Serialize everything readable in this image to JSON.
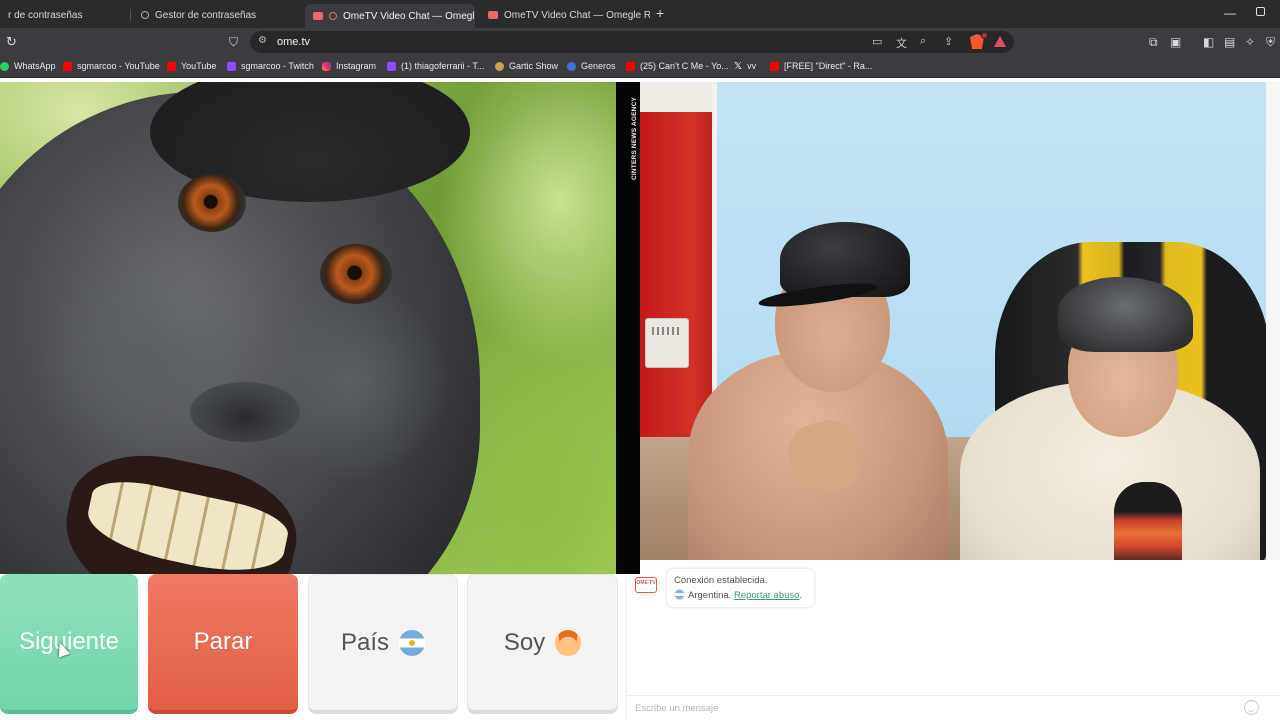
{
  "browser": {
    "tabs": [
      {
        "title": "r de contraseñas"
      },
      {
        "title": "Gestor de contraseñas"
      },
      {
        "title": "OmeTV Video Chat — Omegl",
        "active": true
      },
      {
        "title": "OmeTV Video Chat — Omegle Rand"
      }
    ],
    "url": "ome.tv",
    "bookmarks": [
      {
        "label": "WhatsApp",
        "icon": "whatsapp-icon"
      },
      {
        "label": "sgmarcoo - YouTube",
        "icon": "youtube-icon"
      },
      {
        "label": "YouTube",
        "icon": "youtube-icon"
      },
      {
        "label": "sgmarcoo - Twitch",
        "icon": "twitch-icon"
      },
      {
        "label": "Instagram",
        "icon": "instagram-icon"
      },
      {
        "label": "(1) thiagoferrarii - T...",
        "icon": "twitch-icon"
      },
      {
        "label": "Gartic Show",
        "icon": "gartic-icon"
      },
      {
        "label": "Generos",
        "icon": "globe-icon"
      },
      {
        "label": "(25) Can't C Me - Yo...",
        "icon": "youtube-icon"
      },
      {
        "label": "vv",
        "icon": "x-icon"
      },
      {
        "label": "[FREE] \"Direct\" - Ra...",
        "icon": "youtube-icon"
      }
    ]
  },
  "video": {
    "watermark": "CINTERS NEWS AGENCY"
  },
  "controls": {
    "next_label": "Siguiente",
    "stop_label": "Parar",
    "country_label": "País",
    "gender_label": "Soy"
  },
  "chat": {
    "status_line": "Conexión establecida.",
    "country": "Argentina.",
    "report_link": "Reportar abuso",
    "report_suffix": ".",
    "input_placeholder": "Escribe un mensaje"
  },
  "colors": {
    "next_button": "#76d8ad",
    "stop_button": "#e66650",
    "link": "#3a9b7a"
  }
}
